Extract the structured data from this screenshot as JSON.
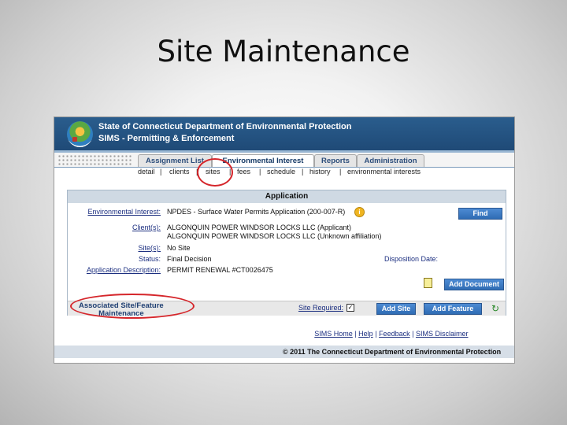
{
  "slide": {
    "title": "Site Maintenance"
  },
  "header": {
    "title": "State of Connecticut Department of Environmental Protection",
    "subtitle": "SIMS - Permitting & Enforcement"
  },
  "tabs": [
    {
      "label": "Assignment List"
    },
    {
      "label": "Environmental Interest"
    },
    {
      "label": "Reports"
    },
    {
      "label": "Administration"
    }
  ],
  "subnav": [
    "detail",
    "|",
    "clients",
    "|",
    "sites",
    "|",
    "fees",
    "|",
    "schedule",
    "|",
    "history",
    "|",
    "environmental interests"
  ],
  "application": {
    "heading": "Application",
    "env_interest_label": "Environmental Interest:",
    "env_interest_value": "NPDES - Surface Water Permits Application (200-007-R)",
    "client_label": "Client(s):",
    "client_1": "ALGONQUIN POWER WINDSOR LOCKS LLC (Applicant)",
    "client_2": "ALGONQUIN POWER WINDSOR LOCKS LLC (Unknown affiliation)",
    "site_label": "Site(s):",
    "site_value": "No Site",
    "status_label": "Status:",
    "status_value": "Final Decision",
    "disposition_label": "Disposition Date:",
    "description_label": "Application Description:",
    "description_value": "PERMIT RENEWAL #CT0026475",
    "find_button": "Find",
    "add_document_button": "Add Document"
  },
  "associated": {
    "title_line1": "Associated Site/Feature",
    "title_line2": "Maintenance",
    "site_required_label": "Site Required:",
    "site_required_check": "✓",
    "add_site_button": "Add Site",
    "add_feature_button": "Add Feature"
  },
  "footer": {
    "links": [
      "SIMS Home",
      "|",
      "Help",
      "|",
      "Feedback",
      "|",
      "SIMS Disclaimer"
    ],
    "copyright": "© 2011 The Connecticut Department of Environmental Protection"
  },
  "colors": {
    "highlight": "#d5262b",
    "header": "#2a5d8d",
    "button": "#3b78c2"
  }
}
